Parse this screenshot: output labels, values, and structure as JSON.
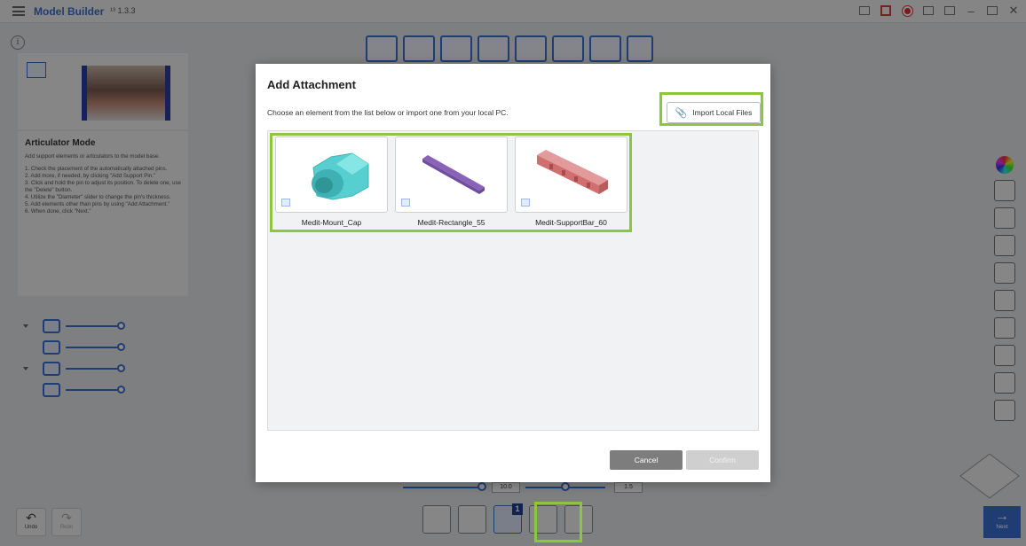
{
  "titlebar": {
    "title": "Model Builder",
    "version": "¹³ 1.3.3"
  },
  "left_panel": {
    "mode_title": "Articulator Mode",
    "mode_description": "Add support elements or articulators to the model base.",
    "steps": [
      "1. Check the placement of the automatically attached pins.",
      "2. Add more, if needed, by clicking \"Add Support Pin.\"",
      "3. Click and hold the pin to adjust its position. To delete one, use the \"Delete\" button.",
      "4. Utilize the \"Diameter\" slider to change the pin's thickness.",
      "5. Add elements other than pins by using \"Add Attachment.\"",
      "6. When done, click \"Next.\""
    ]
  },
  "bottom_params": {
    "left_value": "10.0",
    "right_value": "1.5"
  },
  "bottom_toolbar": {
    "badge": "1"
  },
  "undo": {
    "label": "Undo",
    "glyph": "↶"
  },
  "redo": {
    "label": "Redo",
    "glyph": "↷"
  },
  "next": {
    "label": "Next",
    "glyph": "→"
  },
  "modal": {
    "title": "Add Attachment",
    "subtitle": "Choose an element from the list below or import one from your local PC.",
    "import_label": "Import Local Files",
    "import_icon": "paperclip-icon",
    "items": [
      {
        "label": "Medit-Mount_Cap",
        "color": "#5fd6d6"
      },
      {
        "label": "Medit-Rectangle_55",
        "color": "#8a63b8"
      },
      {
        "label": "Medit-SupportBar_60",
        "color": "#d97a7a"
      }
    ],
    "cancel_label": "Cancel",
    "confirm_label": "Confirm"
  },
  "colors": {
    "accent": "#3b6fd1",
    "highlight": "#8cc63f"
  }
}
